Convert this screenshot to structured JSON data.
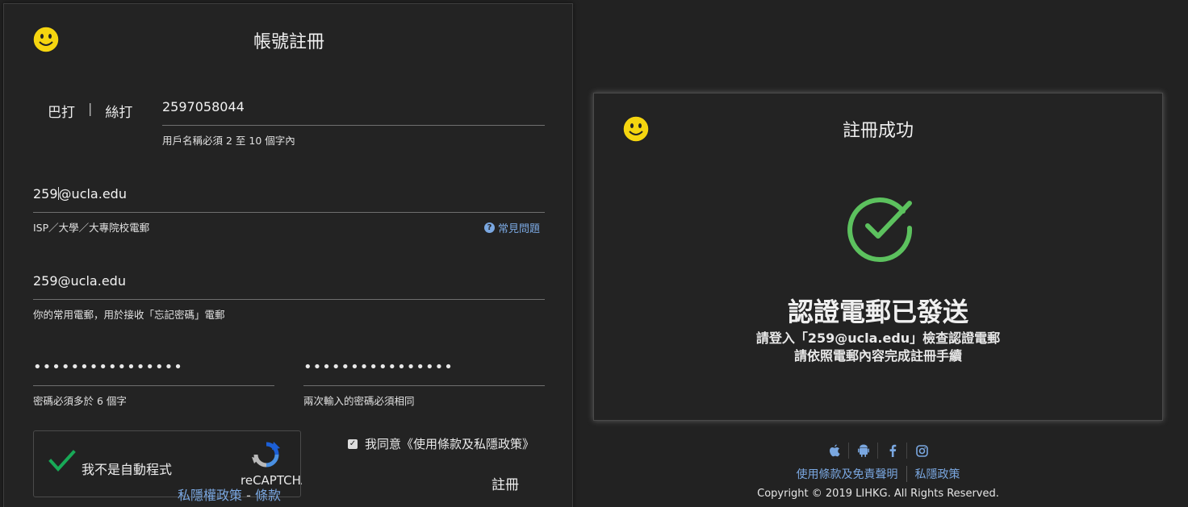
{
  "register": {
    "title": "帳號註冊",
    "segments": [
      "巴打",
      "絲打"
    ],
    "segment_sep": "|",
    "username": {
      "value": "2597058044",
      "hint": "用戶名稱必須 2 至 10 個字內"
    },
    "isp_email": {
      "value_before_caret": "259",
      "value_after_caret": "@ucla.edu",
      "hint": "ISP／大學／大專院校電郵"
    },
    "faq_label": "常見問題",
    "common_email": {
      "value": "259@ucla.edu",
      "hint": "你的常用電郵，用於接收「忘記密碼」電郵"
    },
    "password": {
      "value": "••••••••••••••••",
      "hint": "密碼必須多於 6 個字"
    },
    "password_confirm": {
      "value": "••••••••••••••••",
      "hint": "兩次輸入的密碼必須相同"
    },
    "captcha": {
      "label": "我不是自動程式",
      "brand": "reCAPTCHA",
      "privacy": "私隱權政策",
      "dash": " - ",
      "terms": "條款"
    },
    "agree_label": "我同意《使用條款及私隱政策》",
    "submit_label": "註冊"
  },
  "success": {
    "title": "註冊成功",
    "heading": "認證電郵已發送",
    "line1": "請登入「259@ucla.edu」檢查認證電郵",
    "line2": "請依照電郵內容完成註冊手續"
  },
  "footer": {
    "icons": [
      "apple-icon",
      "android-icon",
      "facebook-icon",
      "instagram-icon"
    ],
    "terms_link": "使用條款及免責聲明",
    "privacy_link": "私隱政策",
    "copyright": "Copyright © 2019 LIHKG. All Rights Reserved."
  },
  "colors": {
    "accent_link": "#7aa7e0",
    "success_green": "#5cc15e",
    "smiley_yellow": "#f5d50f",
    "background": "#222222"
  }
}
